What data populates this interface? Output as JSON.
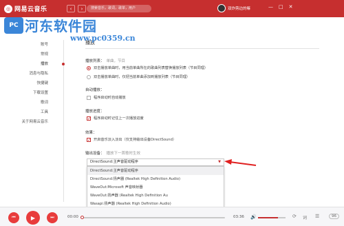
{
  "app": {
    "name": "网易云音乐",
    "logo_glyph": "◎"
  },
  "titlebar": {
    "back_glyph": "‹",
    "forward_glyph": "›",
    "search_placeholder": "搜索音乐，歌词，歌单，用户",
    "user_name": "双炸旁边的嘛",
    "min_glyph": "—",
    "max_glyph": "□",
    "close_glyph": "✕"
  },
  "watermark": {
    "title": "河东软件园",
    "url": "www.pc0359.cn",
    "badge": "PC"
  },
  "sidebar": {
    "items": [
      {
        "label": "账号"
      },
      {
        "label": "常规"
      },
      {
        "label": "播放"
      },
      {
        "label": "消息与隐私"
      },
      {
        "label": "快捷键"
      },
      {
        "label": "下载设置"
      },
      {
        "label": "歌词"
      },
      {
        "label": "工具"
      },
      {
        "label": "关于网易云音乐"
      }
    ]
  },
  "settings": {
    "heading": "播放",
    "playlist": {
      "label": "播放列表：",
      "sub": "单曲，节目",
      "opt1": "双击播放单曲时，用当前单曲所在的歌曲列表替换播放列表（节目同理）",
      "opt2": "双击播放单曲时，仅把当前单曲添加到播放列表（节目同理）"
    },
    "autoplay": {
      "label": "自动播放：",
      "opt": "程序启动时自动播放"
    },
    "progress": {
      "label": "播放进度：",
      "opt": "程序启动时记住上一次播放进度"
    },
    "effect": {
      "label": "效果：",
      "opt": "开启音乐淡入淡出（仅支持输出设备DirectSound）"
    },
    "output": {
      "label": "输出设备：",
      "sub": "播放下一首歌时生效",
      "selected": "DirectSound:主声音驱动程序",
      "caret": "▼",
      "options": [
        "DirectSound:主声音驱动程序",
        "DirectSound:扬声器 (Realtek High Definition Audio)",
        "WaveOut:Microsoft 声音映射器",
        "WaveOut:扬声器 (Realtek High Definition Au",
        "Wasapi:扬声器 (Realtek High Definition Audio)"
      ]
    }
  },
  "player": {
    "prev_glyph": "⏮",
    "play_glyph": "▶",
    "next_glyph": "⏭",
    "time_current": "00:00",
    "time_total": "03:36",
    "progress_fraction": 0,
    "volume_fraction": 0.72,
    "volume_glyph": "🔊",
    "mode_glyph": "⟳",
    "lyric_glyph": "词",
    "list_glyph": "☰",
    "playlist_count": "96"
  },
  "colors": {
    "brand": "#c62f2f",
    "watermark": "#3b86d8"
  }
}
